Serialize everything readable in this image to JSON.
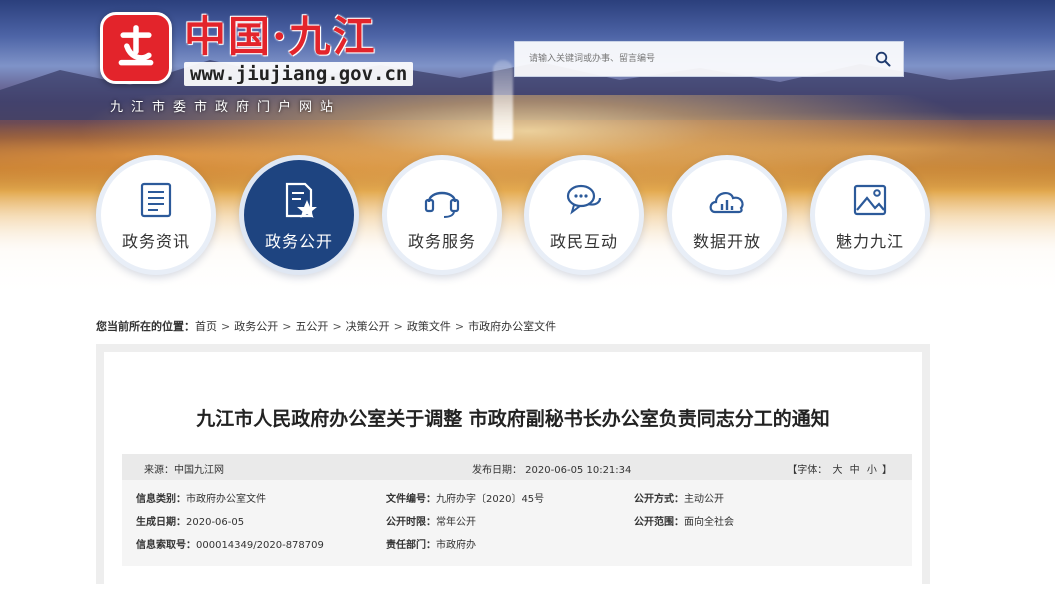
{
  "header": {
    "site_title": "中国·九江",
    "site_url": "www.jiujiang.gov.cn",
    "site_subtitle": "九江市委市政府门户网站",
    "search_placeholder": "请输入关键词或办事、留言编号"
  },
  "nav": {
    "items": [
      {
        "label": "政务资讯",
        "icon": "news-icon",
        "active": false
      },
      {
        "label": "政务公开",
        "icon": "document-star-icon",
        "active": true
      },
      {
        "label": "政务服务",
        "icon": "headset-icon",
        "active": false
      },
      {
        "label": "政民互动",
        "icon": "chat-bubbles-icon",
        "active": false
      },
      {
        "label": "数据开放",
        "icon": "cloud-chart-icon",
        "active": false
      },
      {
        "label": "魅力九江",
        "icon": "picture-icon",
        "active": false
      }
    ]
  },
  "breadcrumb": {
    "prefix": "您当前所在的位置：",
    "items": [
      "首页",
      "政务公开",
      "五公开",
      "决策公开",
      "政策文件",
      "市政府办公室文件"
    ],
    "separator": ">"
  },
  "article": {
    "title": "九江市人民政府办公室关于调整 市政府副秘书长办公室负责同志分工的通知",
    "source": "来源：中国九江网",
    "publish_date": "发布日期： 2020-06-05 10:21:34",
    "font_label_open": "【字体：",
    "font_big": "大",
    "font_mid": "中",
    "font_small": "小",
    "font_label_close": "】",
    "info": {
      "category_label": "信息类别：",
      "category_value": "市政府办公室文件",
      "doc_no_label": "文件编号：",
      "doc_no_value": "九府办字〔2020〕45号",
      "open_mode_label": "公开方式：",
      "open_mode_value": "主动公开",
      "gen_date_label": "生成日期：",
      "gen_date_value": "2020-06-05",
      "open_period_label": "公开时限：",
      "open_period_value": "常年公开",
      "open_scope_label": "公开范围：",
      "open_scope_value": "面向全社会",
      "index_label": "信息索取号：",
      "index_value": "000014349/2020-878709",
      "dept_label": "责任部门：",
      "dept_value": "市政府办"
    }
  },
  "colors": {
    "brand_red": "#e3242b",
    "nav_active": "#1e4480",
    "nav_icon": "#2c5a9a"
  }
}
